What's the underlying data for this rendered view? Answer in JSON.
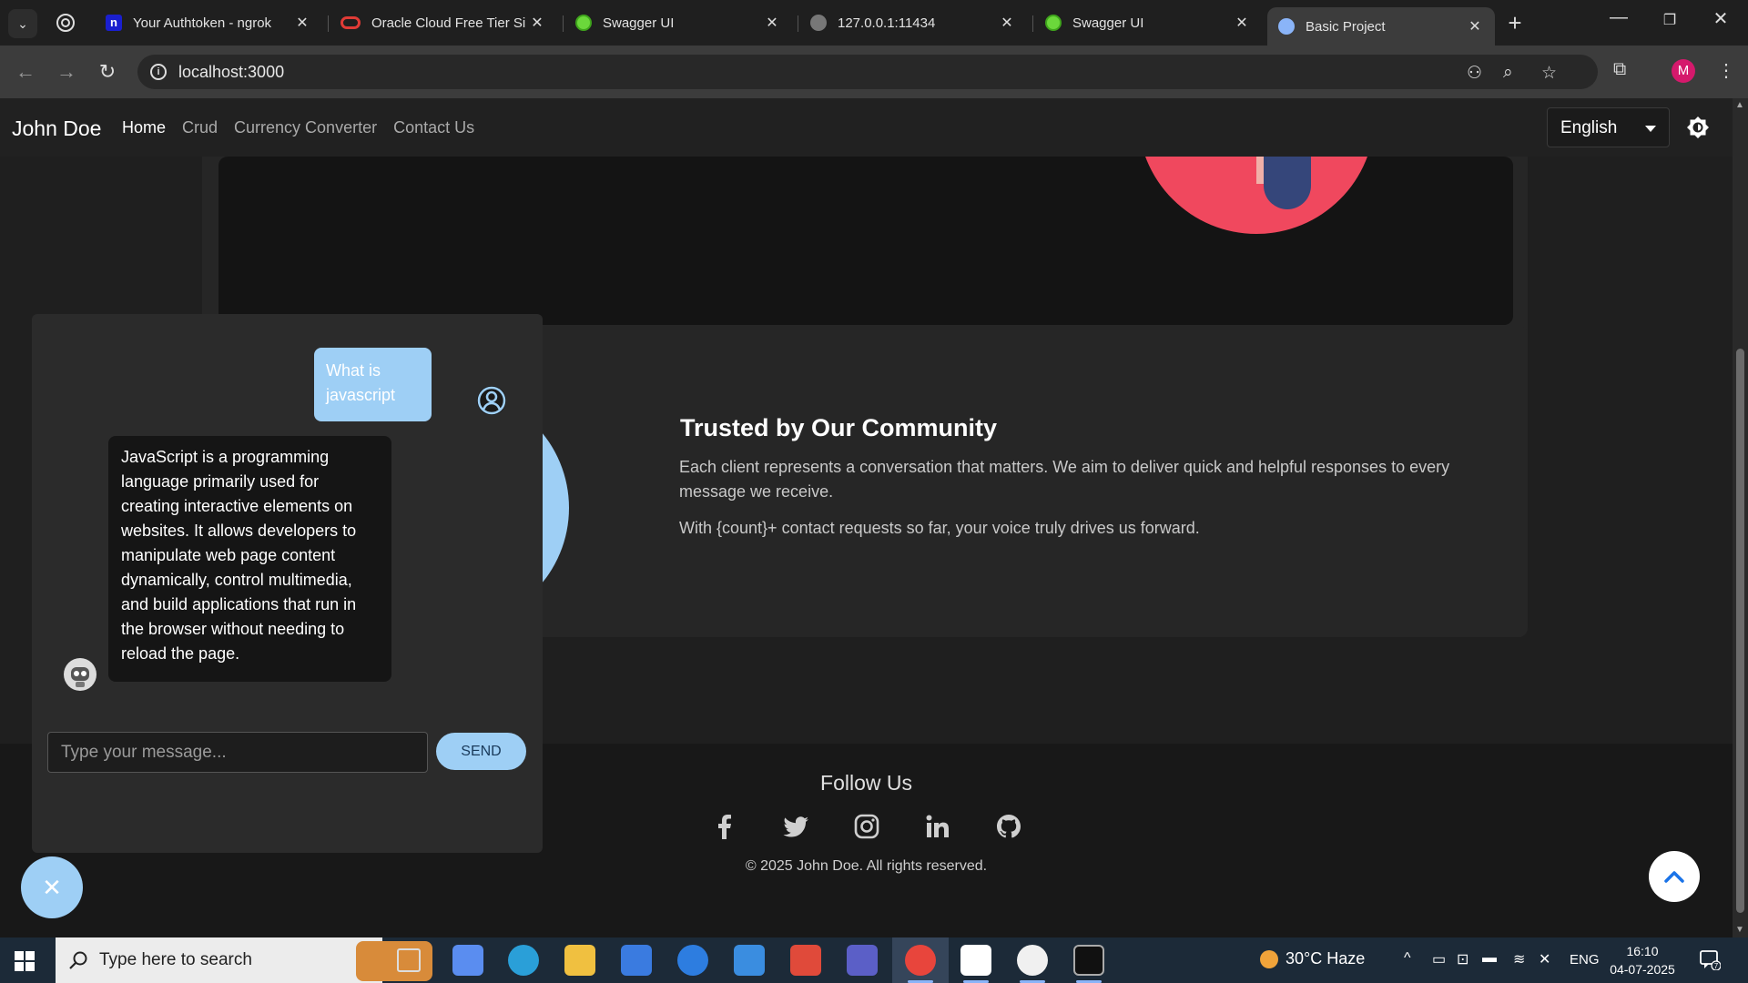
{
  "browser": {
    "tabs": [
      {
        "title": "Your Authtoken - ngrok",
        "favicon": "ngrok-icon"
      },
      {
        "title": "Oracle Cloud Free Tier Si",
        "favicon": "oracle-icon"
      },
      {
        "title": "Swagger UI",
        "favicon": "swagger-icon"
      },
      {
        "title": "127.0.0.1:11434",
        "favicon": "globe-icon"
      },
      {
        "title": "Swagger UI",
        "favicon": "swagger-icon"
      },
      {
        "title": "Basic Project",
        "favicon": "react-icon",
        "active": true
      }
    ],
    "url": "localhost:3000",
    "profile_initial": "M"
  },
  "app": {
    "brand": "John Doe",
    "nav": [
      "Home",
      "Crud",
      "Currency Converter",
      "Contact Us"
    ],
    "active_nav": "Home",
    "language": "English"
  },
  "community": {
    "title": "Trusted by Our Community",
    "p1": "Each client represents a conversation that matters. We aim to deliver quick and helpful responses to every message we receive.",
    "p2": "With {count}+ contact requests so far, your voice truly drives us forward."
  },
  "chat": {
    "user_message": "What is javascript",
    "bot_message": "JavaScript is a programming language primarily used for creating interactive elements on websites. It allows developers to manipulate web page content dynamically, control multimedia, and build applications that run in the browser without needing to reload the page.",
    "input_placeholder": "Type your message...",
    "send_label": "SEND"
  },
  "footer": {
    "follow": "Follow Us",
    "socials": [
      "facebook-icon",
      "twitter-icon",
      "instagram-icon",
      "linkedin-icon",
      "github-icon"
    ],
    "copyright": "© 2025 John Doe. All rights reserved."
  },
  "taskbar": {
    "search_placeholder": "Type here to search",
    "weather": "30°C  Haze",
    "language": "ENG",
    "time": "16:10",
    "date": "04-07-2025",
    "notifications": "7"
  },
  "colors": {
    "accent": "#9ecff5",
    "background": "#1f1f1f",
    "hero": "#f0485e"
  }
}
